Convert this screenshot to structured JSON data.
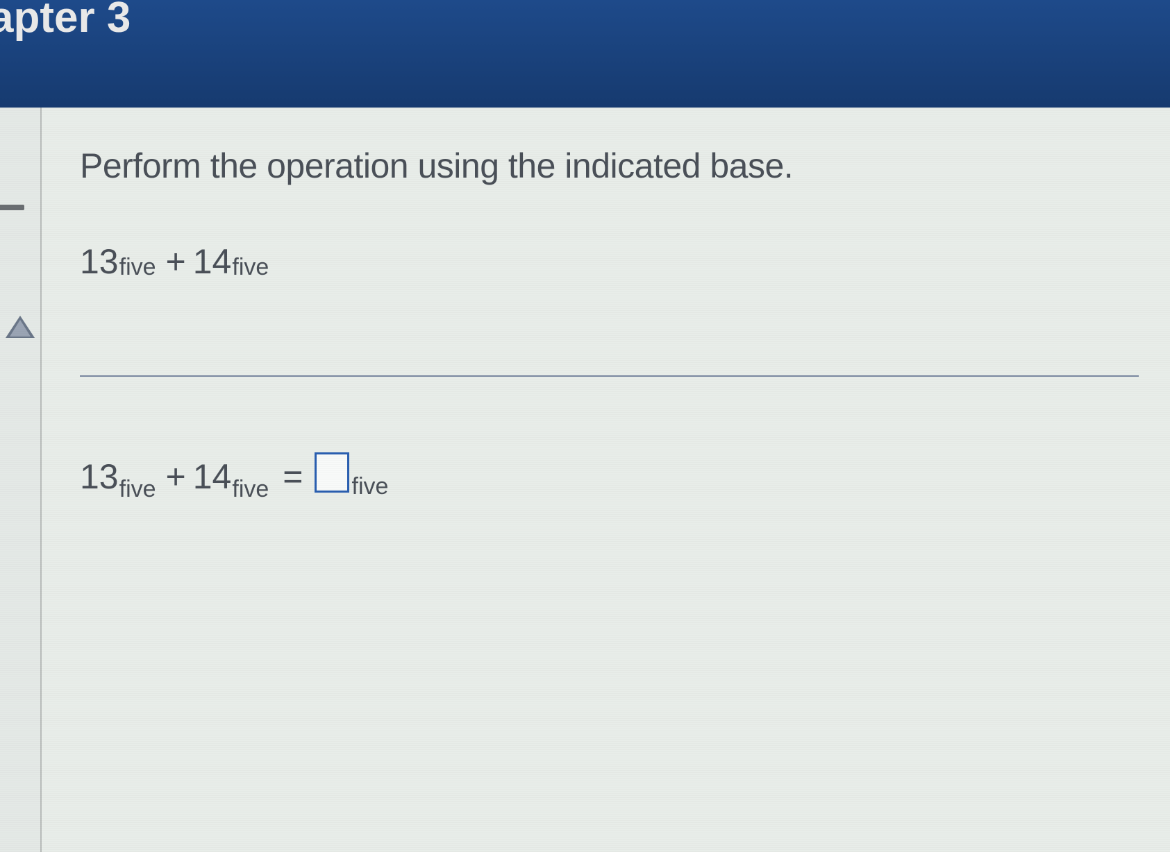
{
  "header": {
    "title_partial": "apter 3"
  },
  "content": {
    "instruction": "Perform the operation using the indicated base.",
    "expr1": {
      "n1": "13",
      "b1": "five",
      "op": "+",
      "n2": "14",
      "b2": "five"
    },
    "expr2": {
      "n1": "13",
      "b1": "five",
      "op": "+",
      "n2": "14",
      "b2": "five",
      "eq": "=",
      "answer": "",
      "answer_base": "five"
    }
  }
}
